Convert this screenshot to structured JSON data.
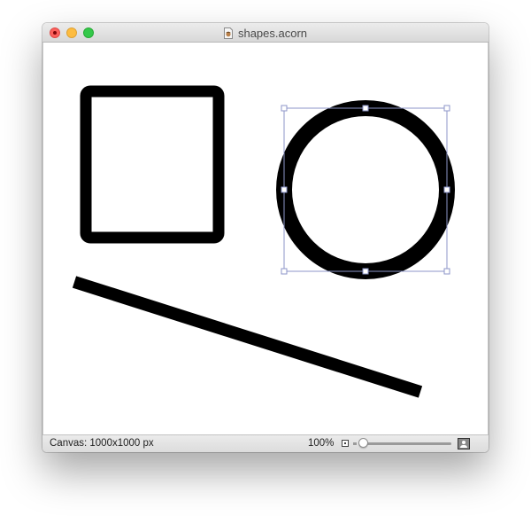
{
  "window": {
    "title": "shapes.acorn",
    "doc_icon": "acorn-document-icon"
  },
  "titlebar": {
    "buttons": [
      "close",
      "minimize",
      "zoom"
    ],
    "colors": {
      "close": "#fc605c",
      "minimize": "#fdbc40",
      "zoom": "#34c84a"
    }
  },
  "canvas": {
    "shapes": [
      {
        "kind": "rounded-rectangle",
        "stroke": "#000000",
        "fill": "none"
      },
      {
        "kind": "circle",
        "stroke": "#000000",
        "fill": "none",
        "selected": true
      },
      {
        "kind": "line",
        "stroke": "#000000"
      }
    ],
    "selection_color": "#8d96c8"
  },
  "status": {
    "canvas_size": "Canvas: 1000x1000 px",
    "zoom": "100%",
    "zoom_slider_value": 0.04,
    "small_image_icon": "small-image-icon",
    "large_image_icon": "large-image-icon"
  }
}
